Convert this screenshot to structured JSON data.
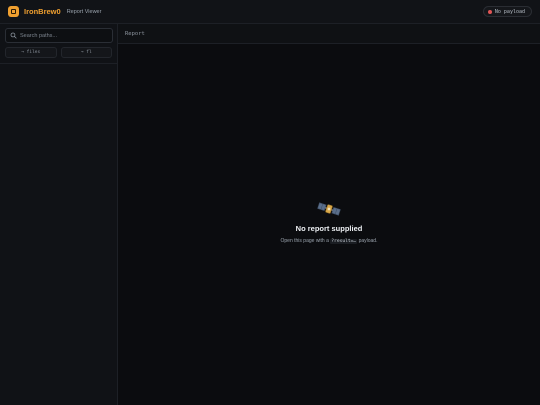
{
  "app": {
    "name": "IronBrew0",
    "subtitle": "Report Viewer",
    "status": "No payload",
    "status_color": "#e05555",
    "accent_color": "#f0a030"
  },
  "sidebar": {
    "search_placeholder": "Search paths...",
    "buttons": [
      {
        "label": "→ files",
        "icon": "arrow-right-icon"
      },
      {
        "label": "→ fl",
        "icon": "arrow-right-icon"
      }
    ]
  },
  "main": {
    "header_title": "Report",
    "empty": {
      "icon": "satellite-icon",
      "title": "No report supplied",
      "desc_before": "Open this page with a ",
      "desc_code": "?result=…",
      "desc_after": " payload."
    }
  }
}
